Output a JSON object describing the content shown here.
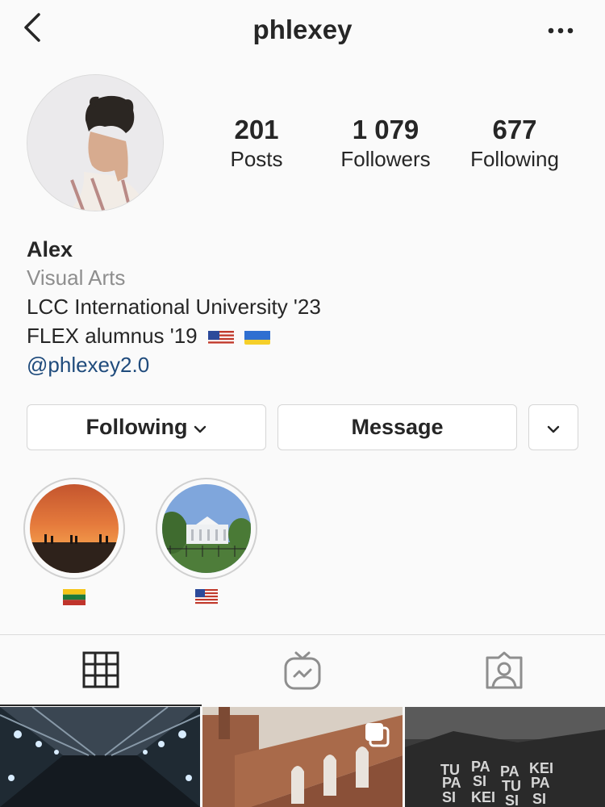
{
  "header": {
    "username": "phlexey",
    "back_icon": "chevron-left-icon",
    "more_icon": "more-horizontal-icon"
  },
  "profile": {
    "stats": [
      {
        "value": "201",
        "label": "Posts"
      },
      {
        "value": "1 079",
        "label": "Followers"
      },
      {
        "value": "677",
        "label": "Following"
      }
    ],
    "name": "Alex",
    "category": "Visual Arts",
    "bio_line1": "LCC International University '23",
    "bio_line2": "FLEX alumnus '19",
    "bio_link": "@phlexey2.0"
  },
  "actions": {
    "following_label": "Following",
    "message_label": "Message"
  },
  "highlights": [
    {
      "label_icon": "lithuania-flag-icon",
      "cover": "sunset-beach"
    },
    {
      "label_icon": "usa-flag-icon",
      "cover": "white-house"
    }
  ],
  "tabs": [
    {
      "name": "posts-grid",
      "icon": "grid-icon",
      "active": true
    },
    {
      "name": "igtv",
      "icon": "tv-icon",
      "active": false
    },
    {
      "name": "tagged",
      "icon": "tagged-person-icon",
      "active": false
    }
  ],
  "colors": {
    "text": "#262626",
    "secondary": "#8e8e8e",
    "link": "#1f4b7c",
    "background": "#fafafa",
    "border": "#dbdbdb"
  }
}
